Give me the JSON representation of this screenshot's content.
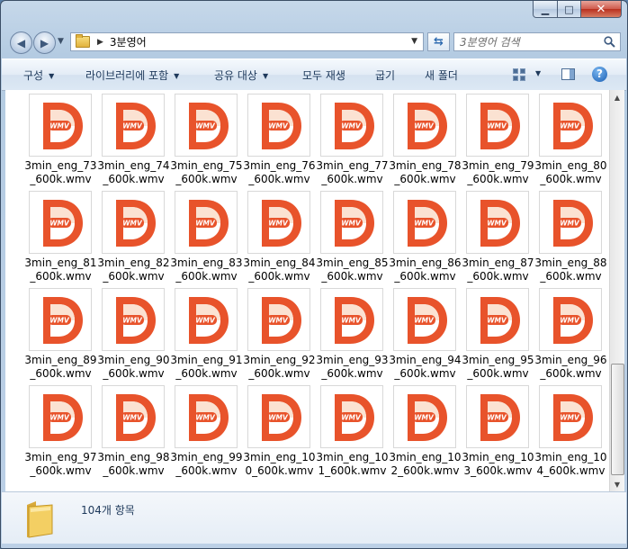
{
  "window": {
    "controls": {
      "minimize": "▁",
      "maximize": "□",
      "close": "✕"
    }
  },
  "address_bar": {
    "breadcrumb": "3분영어",
    "search_placeholder": "3분영어 검색"
  },
  "toolbar": {
    "organize": "구성",
    "include_in_library": "라이브러리에 포함",
    "share_with": "공유 대상",
    "play_all": "모두 재생",
    "burn": "굽기",
    "new_folder": "새 폴더"
  },
  "files": [
    "3min_eng_73_600k.wmv",
    "3min_eng_74_600k.wmv",
    "3min_eng_75_600k.wmv",
    "3min_eng_76_600k.wmv",
    "3min_eng_77_600k.wmv",
    "3min_eng_78_600k.wmv",
    "3min_eng_79_600k.wmv",
    "3min_eng_80_600k.wmv",
    "3min_eng_81_600k.wmv",
    "3min_eng_82_600k.wmv",
    "3min_eng_83_600k.wmv",
    "3min_eng_84_600k.wmv",
    "3min_eng_85_600k.wmv",
    "3min_eng_86_600k.wmv",
    "3min_eng_87_600k.wmv",
    "3min_eng_88_600k.wmv",
    "3min_eng_89_600k.wmv",
    "3min_eng_90_600k.wmv",
    "3min_eng_91_600k.wmv",
    "3min_eng_92_600k.wmv",
    "3min_eng_93_600k.wmv",
    "3min_eng_94_600k.wmv",
    "3min_eng_95_600k.wmv",
    "3min_eng_96_600k.wmv",
    "3min_eng_97_600k.wmv",
    "3min_eng_98_600k.wmv",
    "3min_eng_99_600k.wmv",
    "3min_eng_100_600k.wmv",
    "3min_eng_101_600k.wmv",
    "3min_eng_102_600k.wmv",
    "3min_eng_103_600k.wmv",
    "3min_eng_104_600k.wmv"
  ],
  "file_icon_text": "WMV",
  "status": {
    "item_count": "104개 항목"
  },
  "colors": {
    "logo_orange": "#e8532b",
    "logo_light": "#f6a36b",
    "link_blue": "#1e395b"
  }
}
